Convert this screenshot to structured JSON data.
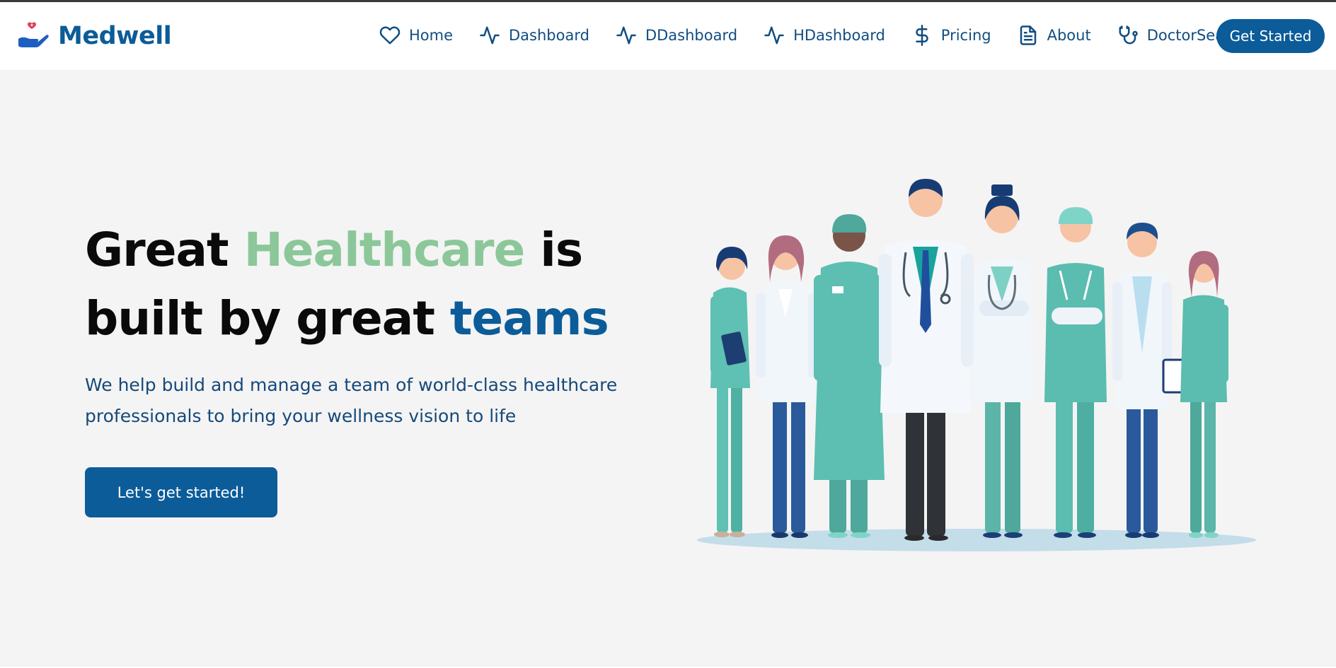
{
  "brand": {
    "name": "Medwell",
    "logo_icon": "heart-in-hand-icon"
  },
  "nav": {
    "items": [
      {
        "label": "Home",
        "icon": "heart-icon"
      },
      {
        "label": "Dashboard",
        "icon": "activity-icon"
      },
      {
        "label": "DDashboard",
        "icon": "activity-icon"
      },
      {
        "label": "HDashboard",
        "icon": "activity-icon"
      },
      {
        "label": "Pricing",
        "icon": "dollar-icon"
      },
      {
        "label": "About",
        "icon": "document-icon"
      },
      {
        "label": "DoctorSearch",
        "icon": "stethoscope-icon"
      }
    ],
    "cta_label": "Get Started"
  },
  "hero": {
    "title_part1": "Great ",
    "title_green": "Healthcare",
    "title_part2": " is built by great ",
    "title_blue": "teams",
    "subtitle": "We help build and manage a team of world-class healthcare professionals to bring your wellness vision to life",
    "cta_label": "Let's get started!",
    "illustration": "medical-team-illustration"
  },
  "colors": {
    "brand_blue": "#0b5c98",
    "accent_green": "#8cc79a",
    "nav_text": "#114d80",
    "hero_bg": "#f4f4f4"
  }
}
